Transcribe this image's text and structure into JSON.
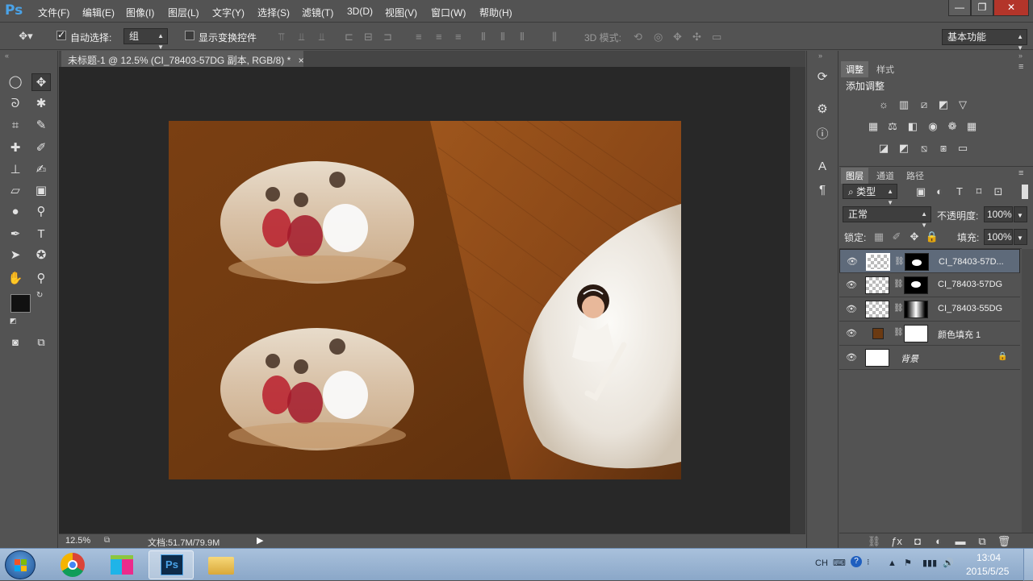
{
  "app": {
    "logo": "Ps"
  },
  "menu": [
    "文件(F)",
    "编辑(E)",
    "图像(I)",
    "图层(L)",
    "文字(Y)",
    "选择(S)",
    "滤镜(T)",
    "3D(D)",
    "视图(V)",
    "窗口(W)",
    "帮助(H)"
  ],
  "window_controls": {
    "minimize": "—",
    "restore": "❐",
    "close": "✕"
  },
  "options_bar": {
    "auto_select_label": "自动选择:",
    "auto_select_value": "组",
    "show_transform_label": "显示变换控件",
    "mode_3d_label": "3D 模式:",
    "workspace": "基本功能"
  },
  "document": {
    "tab_title": "未标题-1 @ 12.5% (CI_78403-57DG 副本, RGB/8) *",
    "tab_close": "×",
    "zoom": "12.5%",
    "doc_info": "文档:51.7M/79.9M"
  },
  "adjustments_panel": {
    "tabs": [
      "调整",
      "样式"
    ],
    "title": "添加调整"
  },
  "layers_panel": {
    "tabs": [
      "图层",
      "通道",
      "路径"
    ],
    "filter_kind": "类型",
    "blend_mode": "正常",
    "opacity_label": "不透明度:",
    "opacity_value": "100%",
    "lock_label": "锁定:",
    "fill_label": "填充:",
    "fill_value": "100%",
    "layers": [
      {
        "name": "CI_78403-57D...",
        "selected": true
      },
      {
        "name": "CI_78403-57DG",
        "selected": false
      },
      {
        "name": "CI_78403-55DG",
        "selected": false
      },
      {
        "name": "颜色填充 1",
        "selected": false
      },
      {
        "name": "背景",
        "selected": false
      }
    ]
  },
  "taskbar": {
    "ime": "CH",
    "time": "13:04",
    "date": "2015/5/25",
    "ps_label": "Ps"
  },
  "colors": {
    "canvas_brown": "#6b3a12",
    "ps_blue": "#4aa3e8",
    "selected_layer": "#5e6a7a"
  }
}
